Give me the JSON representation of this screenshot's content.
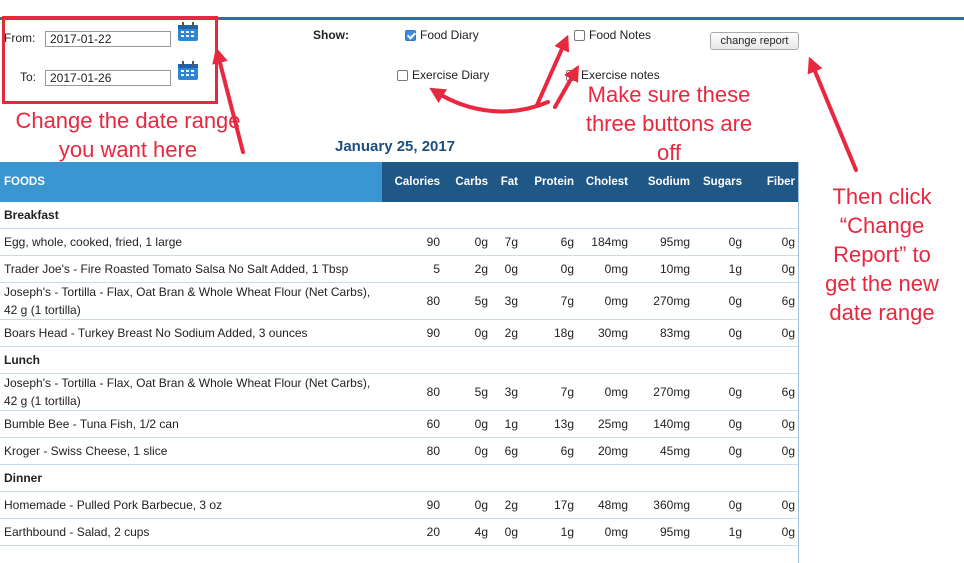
{
  "header": {
    "from_label": "From:",
    "from_value": "2017-01-22",
    "to_label": "To:",
    "to_value": "2017-01-26",
    "show_label": "Show:",
    "checkboxes": [
      {
        "label": "Food Diary",
        "checked": true
      },
      {
        "label": "Food Notes",
        "checked": false
      },
      {
        "label": "Exercise Diary",
        "checked": false
      },
      {
        "label": "Exercise notes",
        "checked": false
      }
    ],
    "change_report_label": "change report"
  },
  "annotations": {
    "date_range": "Change the date range you want here",
    "buttons_off": "Make sure these three buttons are off",
    "click_change": "Then click “Change Report” to get the new date range",
    "color": "#e8283f"
  },
  "report": {
    "date_title": "January 25, 2017",
    "columns": [
      "FOODS",
      "Calories",
      "Carbs",
      "Fat",
      "Protein",
      "Cholest",
      "Sodium",
      "Sugars",
      "Fiber"
    ],
    "meals": [
      {
        "name": "Breakfast",
        "items": [
          {
            "food": "Egg, whole, cooked, fried, 1 large",
            "values": [
              "90",
              "0g",
              "7g",
              "6g",
              "184mg",
              "95mg",
              "0g",
              "0g"
            ]
          },
          {
            "food": "Trader Joe's - Fire Roasted Tomato Salsa No Salt Added, 1 Tbsp",
            "values": [
              "5",
              "2g",
              "0g",
              "0g",
              "0mg",
              "10mg",
              "1g",
              "0g"
            ]
          },
          {
            "food": "Joseph's - Tortilla - Flax, Oat Bran & Whole Wheat Flour (Net Carbs), 42 g (1 tortilla)",
            "values": [
              "80",
              "5g",
              "3g",
              "7g",
              "0mg",
              "270mg",
              "0g",
              "6g"
            ]
          },
          {
            "food": "Boars Head - Turkey Breast No Sodium Added, 3 ounces",
            "values": [
              "90",
              "0g",
              "2g",
              "18g",
              "30mg",
              "83mg",
              "0g",
              "0g"
            ]
          }
        ]
      },
      {
        "name": "Lunch",
        "items": [
          {
            "food": "Joseph's - Tortilla - Flax, Oat Bran & Whole Wheat Flour (Net Carbs), 42 g (1 tortilla)",
            "values": [
              "80",
              "5g",
              "3g",
              "7g",
              "0mg",
              "270mg",
              "0g",
              "6g"
            ]
          },
          {
            "food": "Bumble Bee - Tuna Fish, 1/2 can",
            "values": [
              "60",
              "0g",
              "1g",
              "13g",
              "25mg",
              "140mg",
              "0g",
              "0g"
            ]
          },
          {
            "food": "Kroger - Swiss Cheese, 1 slice",
            "values": [
              "80",
              "0g",
              "6g",
              "6g",
              "20mg",
              "45mg",
              "0g",
              "0g"
            ]
          }
        ]
      },
      {
        "name": "Dinner",
        "items": [
          {
            "food": "Homemade - Pulled Pork Barbecue, 3 oz",
            "values": [
              "90",
              "0g",
              "2g",
              "17g",
              "48mg",
              "360mg",
              "0g",
              "0g"
            ]
          },
          {
            "food": "Earthbound - Salad, 2 cups",
            "values": [
              "20",
              "4g",
              "0g",
              "1g",
              "0mg",
              "95mg",
              "1g",
              "0g"
            ]
          }
        ]
      }
    ]
  }
}
